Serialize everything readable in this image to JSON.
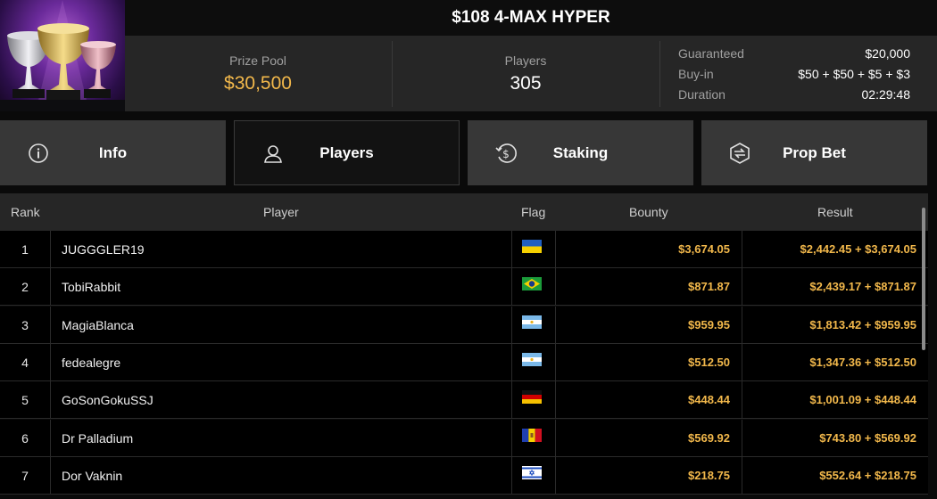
{
  "tournament": {
    "title": "$108 4-MAX HYPER",
    "prize_pool_label": "Prize Pool",
    "prize_pool_value": "$30,500",
    "players_label": "Players",
    "players_value": "305",
    "details": [
      {
        "label": "Guaranteed",
        "value": "$20,000"
      },
      {
        "label": "Buy-in",
        "value": "$50 + $50 + $5 + $3"
      },
      {
        "label": "Duration",
        "value": "02:29:48"
      }
    ]
  },
  "tabs": [
    {
      "label": "Info",
      "icon": "info-icon"
    },
    {
      "label": "Players",
      "icon": "user-icon",
      "active": true
    },
    {
      "label": "Staking",
      "icon": "dollar-cycle-icon"
    },
    {
      "label": "Prop Bet",
      "icon": "prop-bet-icon"
    }
  ],
  "table": {
    "headers": {
      "rank": "Rank",
      "player": "Player",
      "flag": "Flag",
      "bounty": "Bounty",
      "result": "Result"
    },
    "rows": [
      {
        "rank": "1",
        "player": "JUGGGLER19",
        "flag": "ukraine",
        "bounty": "$3,674.05",
        "result": "$2,442.45 + $3,674.05"
      },
      {
        "rank": "2",
        "player": "TobiRabbit",
        "flag": "brazil",
        "bounty": "$871.87",
        "result": "$2,439.17 + $871.87"
      },
      {
        "rank": "3",
        "player": "MagiaBlanca",
        "flag": "argentina",
        "bounty": "$959.95",
        "result": "$1,813.42 + $959.95"
      },
      {
        "rank": "4",
        "player": "fedealegre",
        "flag": "argentina",
        "bounty": "$512.50",
        "result": "$1,347.36 + $512.50"
      },
      {
        "rank": "5",
        "player": "GoSonGokuSSJ",
        "flag": "germany",
        "bounty": "$448.44",
        "result": "$1,001.09 + $448.44"
      },
      {
        "rank": "6",
        "player": "Dr Palladium",
        "flag": "moldova",
        "bounty": "$569.92",
        "result": "$743.80 + $569.92"
      },
      {
        "rank": "7",
        "player": "Dor Vaknin",
        "flag": "israel",
        "bounty": "$218.75",
        "result": "$552.64 + $218.75"
      }
    ]
  },
  "colors": {
    "accent_gold": "#f2b84b",
    "tab_bg": "#373737",
    "active_tab_bg": "#121212"
  }
}
